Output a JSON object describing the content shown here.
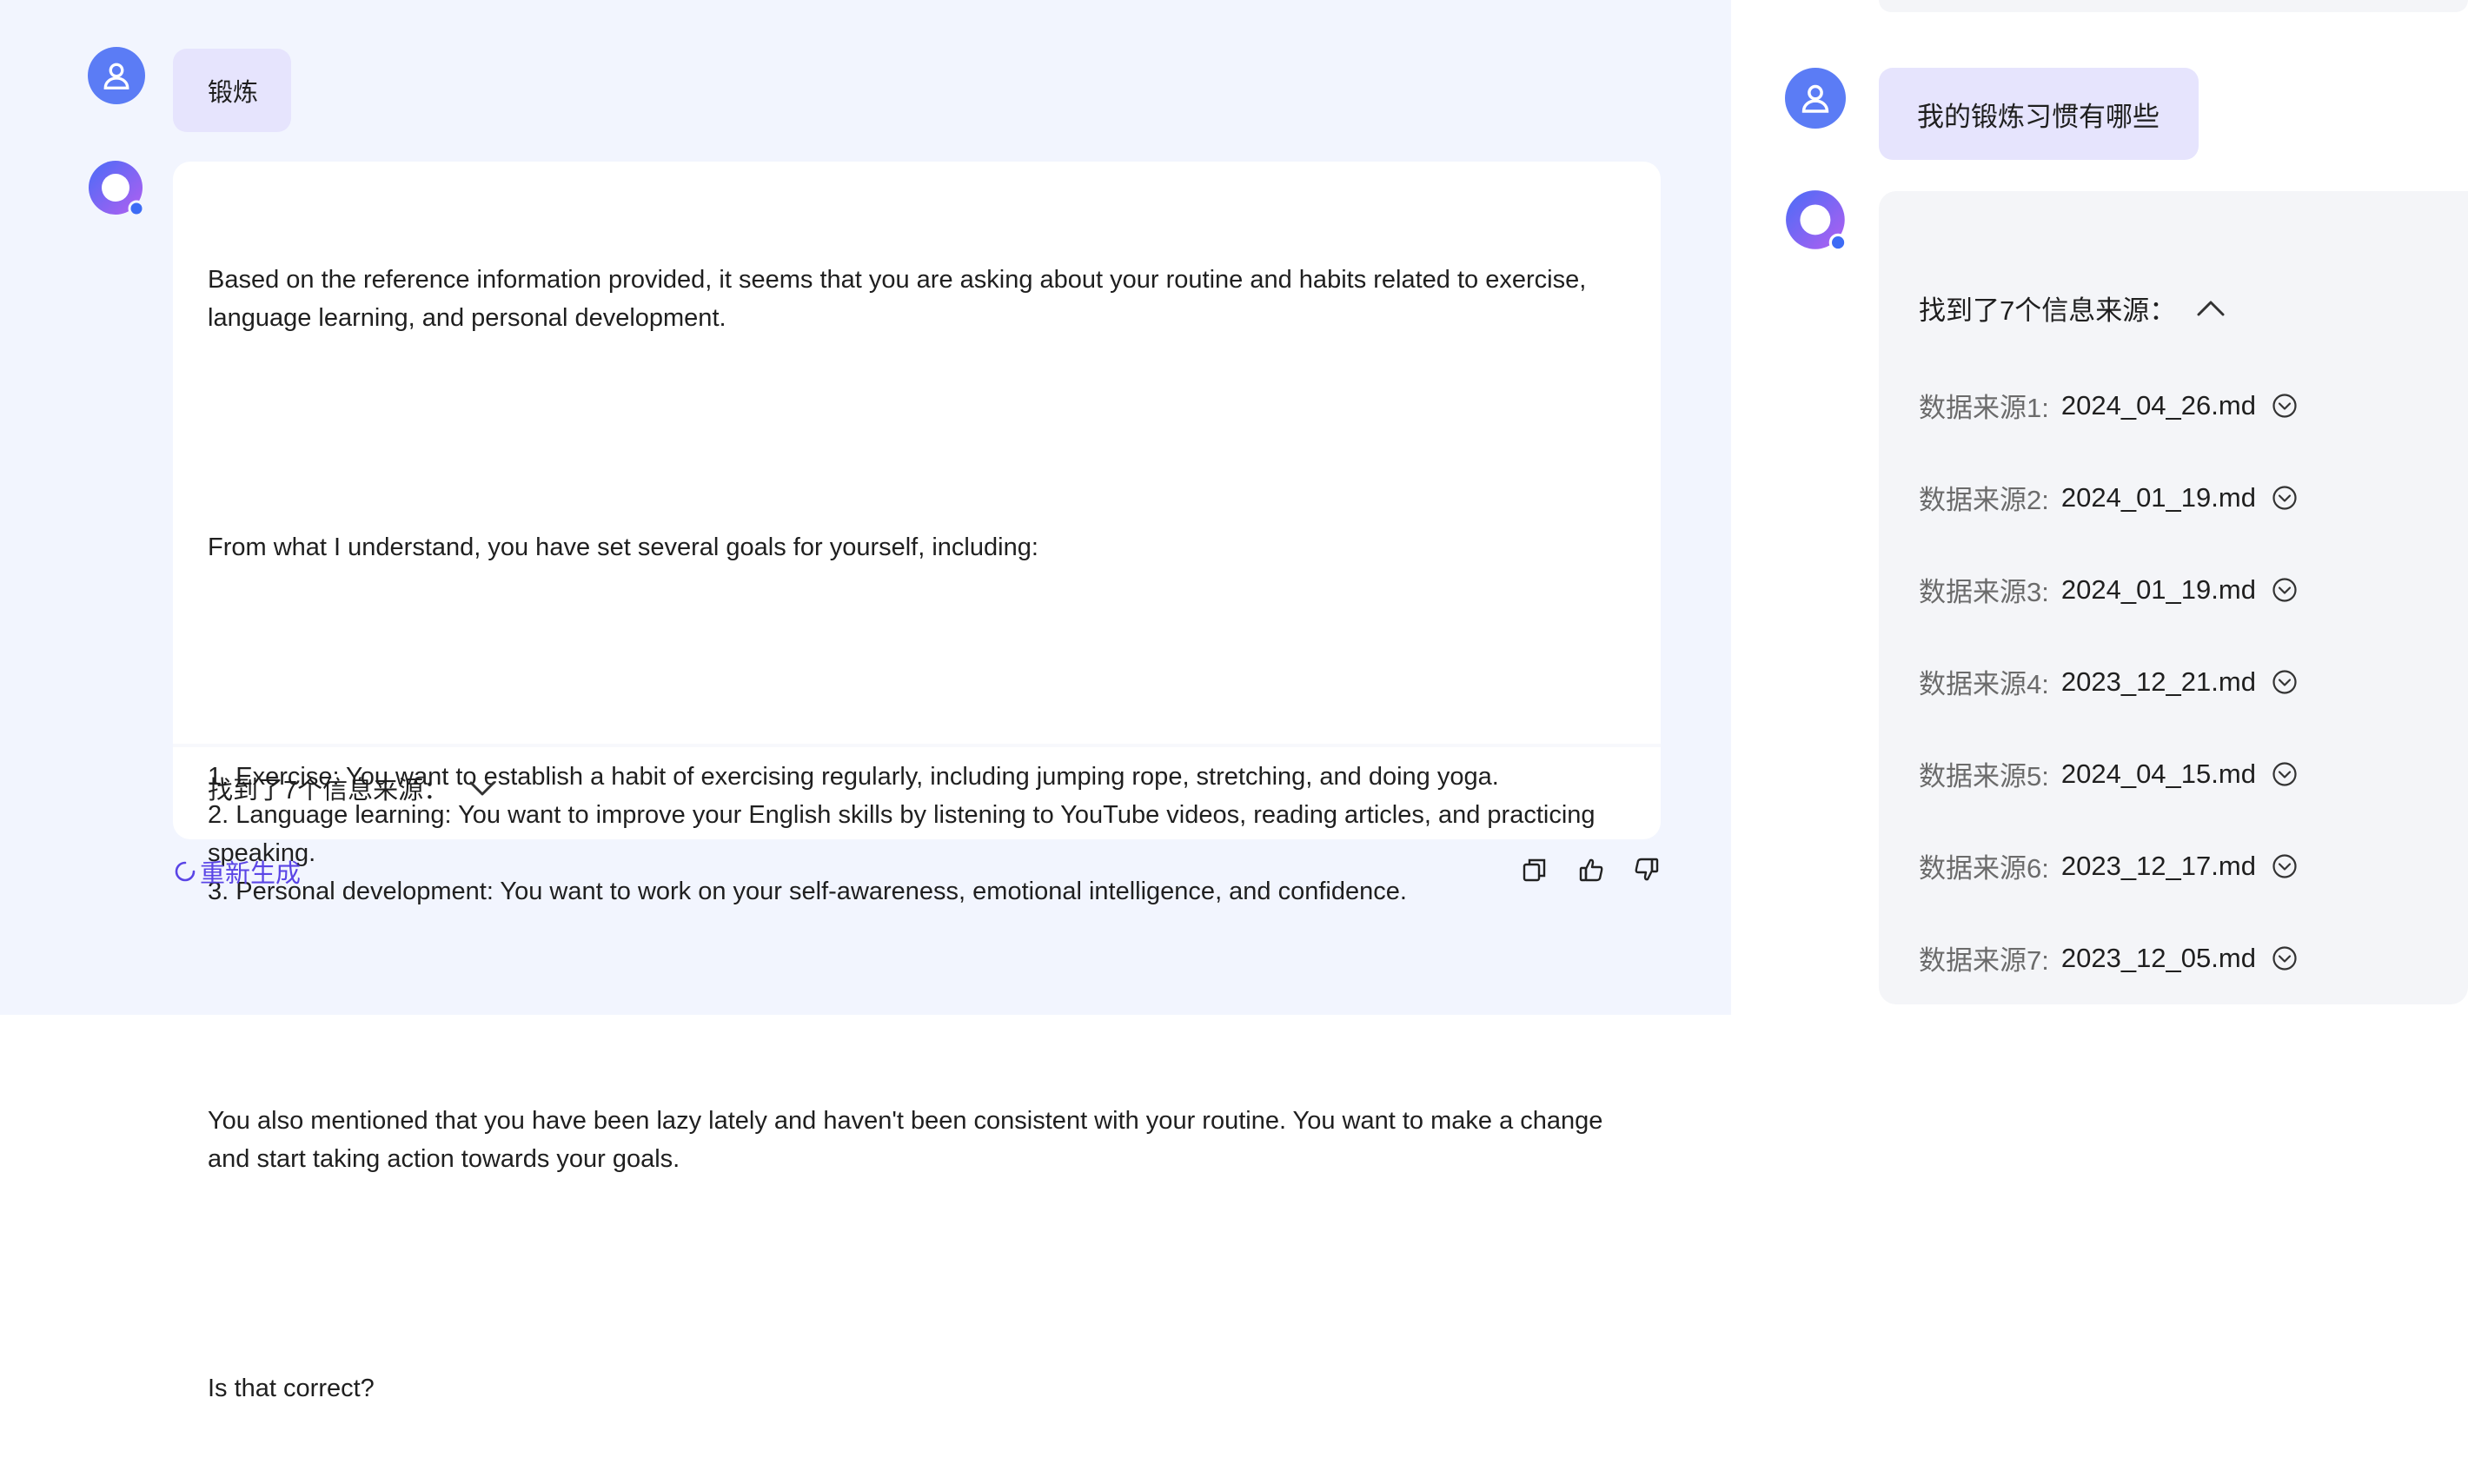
{
  "left": {
    "user_message": "锻炼",
    "answer": {
      "paragraphs": [
        "Based on the reference information provided, it seems that you are asking about your routine and habits related to exercise,\nlanguage learning, and personal development.",
        "From what I understand, you have set several goals for yourself, including:",
        "1. Exercise: You want to establish a habit of exercising regularly, including jumping rope, stretching, and doing yoga.\n2. Language learning: You want to improve your English skills by listening to YouTube videos, reading articles, and practicing\nspeaking.\n3. Personal development: You want to work on your self-awareness, emotional intelligence, and confidence.",
        "You also mentioned that you have been lazy lately and haven't been consistent with your routine. You want to make a change\nand start taking action towards your goals.",
        "Is that correct?"
      ],
      "sources_toggle_label": "找到了7个信息来源：",
      "sources_expanded": false
    },
    "regenerate_label": "重新生成",
    "action_icons": [
      "copy-icon",
      "thumbs-up-icon",
      "thumbs-down-icon"
    ]
  },
  "right": {
    "user_message": "我的锻炼习惯有哪些",
    "sources_toggle_label": "找到了7个信息来源：",
    "sources_expanded": true,
    "sources": [
      {
        "label": "数据来源1:",
        "name": "2024_04_26.md"
      },
      {
        "label": "数据来源2:",
        "name": "2024_01_19.md"
      },
      {
        "label": "数据来源3:",
        "name": "2024_01_19.md"
      },
      {
        "label": "数据来源4:",
        "name": "2023_12_21.md"
      },
      {
        "label": "数据来源5:",
        "name": "2024_04_15.md"
      },
      {
        "label": "数据来源6:",
        "name": "2023_12_17.md"
      },
      {
        "label": "数据来源7:",
        "name": "2023_12_05.md"
      }
    ]
  },
  "colors": {
    "left_background": "#f2f5fe",
    "user_bubble": "#e6e4fd",
    "user_avatar": "#5b7cf5",
    "ai_avatar_gradient": [
      "#4a6cf7",
      "#a65cf0"
    ],
    "accent": "#5a45e6",
    "sources_card": "#f4f5f8"
  }
}
